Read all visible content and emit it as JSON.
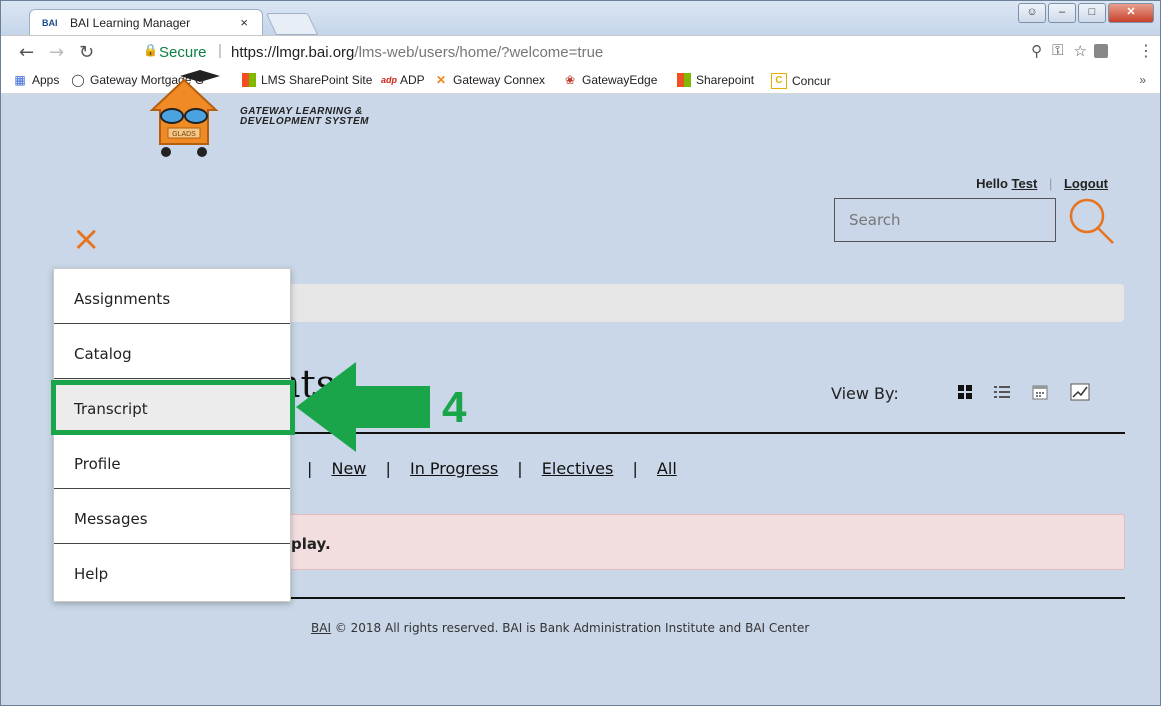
{
  "browser": {
    "tab_title": "BAI Learning Manager",
    "tab_favicon": "BAI",
    "tab_close": "×",
    "secure_label": "Secure",
    "url_host": "https://lmgr.bai.org",
    "url_path": "/lms-web/users/home/?welcome=true",
    "bookmarks": [
      {
        "label": "Apps",
        "icon": "apps-grid-icon"
      },
      {
        "label": "Gateway Mortgage G",
        "icon": "gateway-icon"
      },
      {
        "label": "LMS SharePoint Site",
        "icon": "windows-icon"
      },
      {
        "label": "ADP",
        "icon": "adp-icon"
      },
      {
        "label": "Gateway Connex",
        "icon": "connex-icon"
      },
      {
        "label": "GatewayEdge",
        "icon": "gatewayedge-icon"
      },
      {
        "label": "Sharepoint",
        "icon": "windows-icon"
      },
      {
        "label": "Concur",
        "icon": "concur-icon"
      }
    ],
    "bookmarks_more": "»"
  },
  "header": {
    "logo_line1": "Gateway Learning &",
    "logo_line2": "Development System",
    "logo_badge": "GLADS",
    "close_symbol": "×",
    "hello_prefix": "Hello",
    "user_name": "Test",
    "logout": "Logout",
    "search_placeholder": "Search"
  },
  "main": {
    "heading_fragment": "nts",
    "view_by_label": "View By:",
    "filters": [
      "New",
      "In Progress",
      "Electives",
      "All"
    ],
    "alert_fragment": "play."
  },
  "menu": {
    "items": [
      "Assignments",
      "Catalog",
      "Transcript",
      "Profile",
      "Messages",
      "Help"
    ],
    "active": "Transcript"
  },
  "annotation": {
    "step_number": "4",
    "color": "#1aa54b"
  },
  "footer": {
    "link": "BAI",
    "text": "© 2018 All rights reserved. BAI is Bank Administration Institute and BAI Center"
  },
  "colors": {
    "accent_orange": "#e8731f",
    "alert_bg": "#f3dedf",
    "secure_green": "#0b8043"
  }
}
